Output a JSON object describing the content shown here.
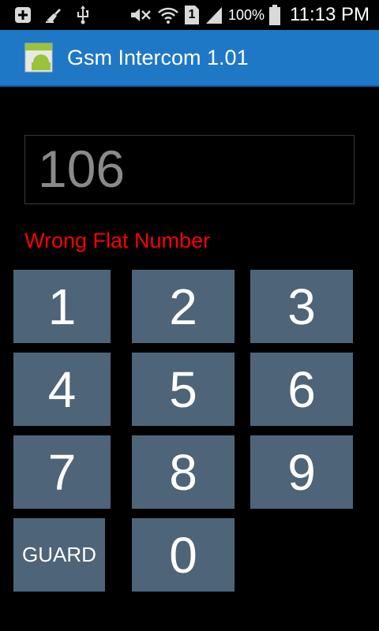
{
  "status_bar": {
    "icons": [
      "plus-box-icon",
      "cleaner-icon",
      "usb-icon",
      "mute-icon",
      "wifi-icon",
      "sim-1-icon",
      "signal-icon",
      "battery-icon"
    ],
    "sim_label": "1",
    "battery": "100%",
    "time": "11:13 PM"
  },
  "action_bar": {
    "title": "Gsm Intercom 1.01",
    "color": "#1f78c6"
  },
  "display": {
    "value": "106"
  },
  "message": {
    "text": "Wrong Flat Number",
    "color": "#ff0000"
  },
  "keypad": {
    "key_color": "#4e6478",
    "keys": [
      "1",
      "2",
      "3",
      "4",
      "5",
      "6",
      "7",
      "8",
      "9",
      "GUARD",
      "0"
    ]
  }
}
